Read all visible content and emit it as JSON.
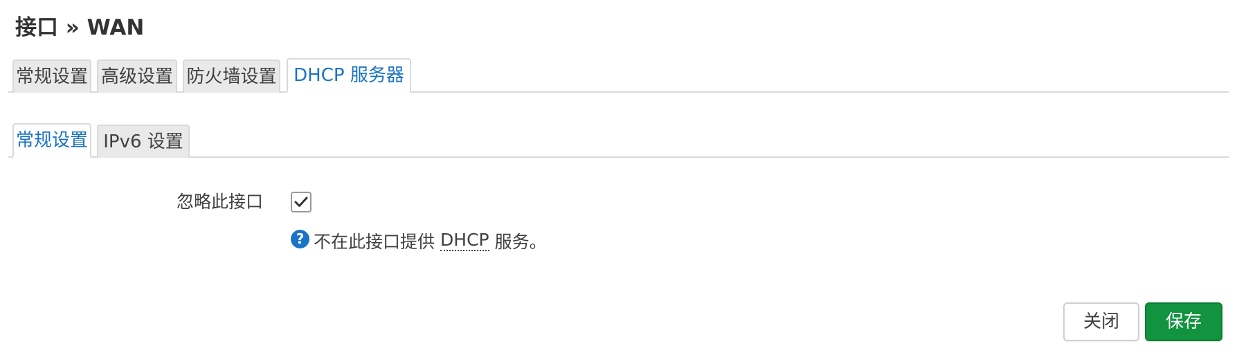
{
  "header": {
    "title": "接口 » WAN"
  },
  "primary_tabs": [
    {
      "label": "常规设置",
      "active": false
    },
    {
      "label": "高级设置",
      "active": false
    },
    {
      "label": "防火墙设置",
      "active": false
    },
    {
      "label": "DHCP 服务器",
      "active": true
    }
  ],
  "secondary_tabs": [
    {
      "label": "常规设置",
      "active": true
    },
    {
      "label": "IPv6 设置",
      "active": false
    }
  ],
  "form": {
    "ignore_interface": {
      "label": "忽略此接口",
      "checked": true,
      "help_prefix": "不在此接口提供",
      "help_abbr": "DHCP",
      "help_suffix": "服务。",
      "help_icon": "help-icon"
    }
  },
  "buttons": {
    "close_label": "关闭",
    "save_label": "保存"
  },
  "colors": {
    "accent": "#1a73c6",
    "save_button": "#12933f",
    "tab_inactive_bg": "#e9e9e9",
    "border": "#d9d9d9"
  }
}
